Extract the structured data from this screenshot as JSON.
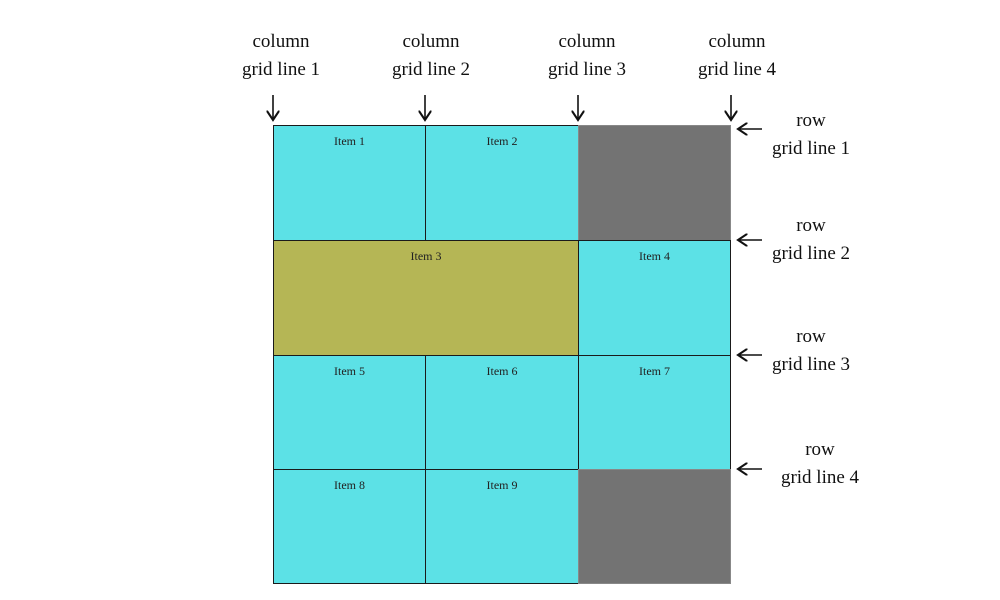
{
  "column_labels": [
    {
      "line1": "column",
      "line2": "grid line 1"
    },
    {
      "line1": "column",
      "line2": "grid line 2"
    },
    {
      "line1": "column",
      "line2": "grid line 3"
    },
    {
      "line1": "column",
      "line2": "grid line 4"
    }
  ],
  "row_labels": [
    {
      "line1": "row",
      "line2": "grid line 1"
    },
    {
      "line1": "row",
      "line2": "grid line 2"
    },
    {
      "line1": "row",
      "line2": "grid line 3"
    },
    {
      "line1": "row",
      "line2": "grid line 4"
    }
  ],
  "items": [
    "Item 1",
    "Item 2",
    "Item 3",
    "Item 4",
    "Item 5",
    "Item 6",
    "Item 7",
    "Item 8",
    "Item 9"
  ],
  "colors": {
    "item": "#5ce1e6",
    "spanning_item": "#b5b655",
    "empty_cell": "#737373"
  }
}
